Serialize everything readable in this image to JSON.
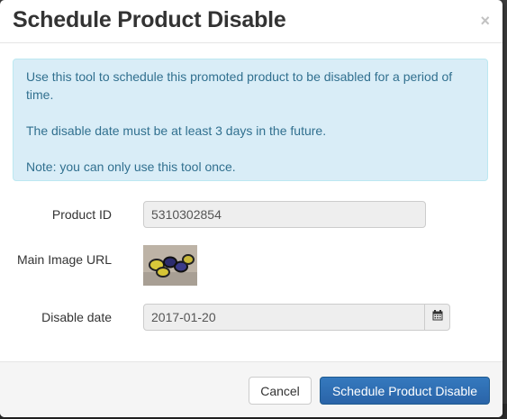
{
  "modal": {
    "title": "Schedule Product Disable",
    "close_label": "×"
  },
  "alert": {
    "line1": "Use this tool to schedule this promoted product to be disabled for a period of time.",
    "line2": "The disable date must be at least 3 days in the future.",
    "line3": "Note: you can only use this tool once."
  },
  "form": {
    "product_id_label": "Product ID",
    "product_id_value": "5310302854",
    "image_url_label": "Main Image URL",
    "image_thumb_icon": "sunglasses-product-image",
    "disable_date_label": "Disable date",
    "disable_date_value": "2017-01-20",
    "calendar_icon": "calendar-icon"
  },
  "footer": {
    "cancel_label": "Cancel",
    "submit_label": "Schedule Product Disable"
  },
  "colors": {
    "alert_bg": "#d9edf7",
    "alert_text": "#31708f",
    "primary": "#337ab7"
  }
}
